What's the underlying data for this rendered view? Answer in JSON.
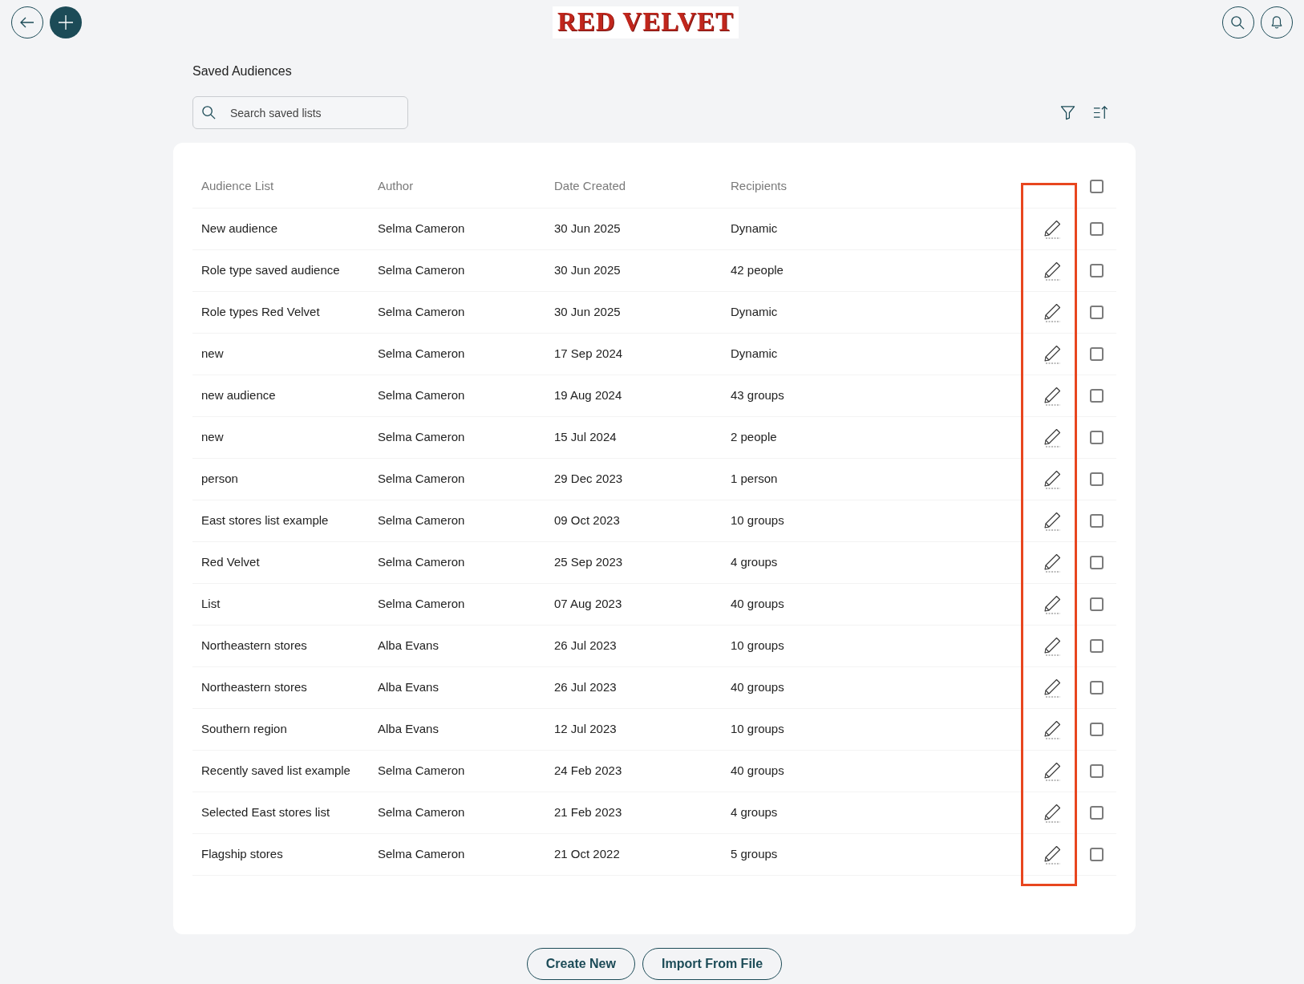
{
  "header": {
    "logo": "RED VELVET"
  },
  "page_title": "Saved Audiences",
  "search": {
    "placeholder": "Search saved lists"
  },
  "table": {
    "columns": [
      "Audience List",
      "Author",
      "Date Created",
      "Recipients"
    ],
    "select_all": {
      "checked": false
    },
    "edit_column_highlighted": true,
    "rows": [
      {
        "name": "New audience",
        "author": "Selma Cameron",
        "date": "30 Jun 2025",
        "recipients": "Dynamic",
        "checked": false
      },
      {
        "name": "Role type saved audience",
        "author": "Selma Cameron",
        "date": "30 Jun 2025",
        "recipients": "42 people",
        "checked": false
      },
      {
        "name": "Role types Red Velvet",
        "author": "Selma Cameron",
        "date": "30 Jun 2025",
        "recipients": "Dynamic",
        "checked": false
      },
      {
        "name": "new",
        "author": "Selma Cameron",
        "date": "17 Sep 2024",
        "recipients": "Dynamic",
        "checked": false
      },
      {
        "name": "new audience",
        "author": "Selma Cameron",
        "date": "19 Aug 2024",
        "recipients": "43 groups",
        "checked": false
      },
      {
        "name": "new",
        "author": "Selma Cameron",
        "date": "15 Jul 2024",
        "recipients": "2 people",
        "checked": false
      },
      {
        "name": "person",
        "author": "Selma Cameron",
        "date": "29 Dec 2023",
        "recipients": "1 person",
        "checked": false
      },
      {
        "name": "East stores list example",
        "author": "Selma Cameron",
        "date": "09 Oct 2023",
        "recipients": "10 groups",
        "checked": false
      },
      {
        "name": "Red Velvet",
        "author": "Selma Cameron",
        "date": "25 Sep 2023",
        "recipients": "4 groups",
        "checked": false
      },
      {
        "name": "List",
        "author": "Selma Cameron",
        "date": "07 Aug 2023",
        "recipients": "40 groups",
        "checked": false
      },
      {
        "name": "Northeastern stores",
        "author": "Alba Evans",
        "date": "26 Jul 2023",
        "recipients": "10 groups",
        "checked": false
      },
      {
        "name": "Northeastern stores",
        "author": "Alba Evans",
        "date": "26 Jul 2023",
        "recipients": "40 groups",
        "checked": false
      },
      {
        "name": "Southern region",
        "author": "Alba Evans",
        "date": "12 Jul 2023",
        "recipients": "10 groups",
        "checked": false
      },
      {
        "name": "Recently saved list example",
        "author": "Selma Cameron",
        "date": "24 Feb 2023",
        "recipients": "40 groups",
        "checked": false
      },
      {
        "name": "Selected East stores list",
        "author": "Selma Cameron",
        "date": "21 Feb 2023",
        "recipients": "4 groups",
        "checked": false
      },
      {
        "name": "Flagship stores",
        "author": "Selma Cameron",
        "date": "21 Oct 2022",
        "recipients": "5 groups",
        "checked": false
      }
    ]
  },
  "buttons": [
    "Create New",
    "Import From File"
  ]
}
